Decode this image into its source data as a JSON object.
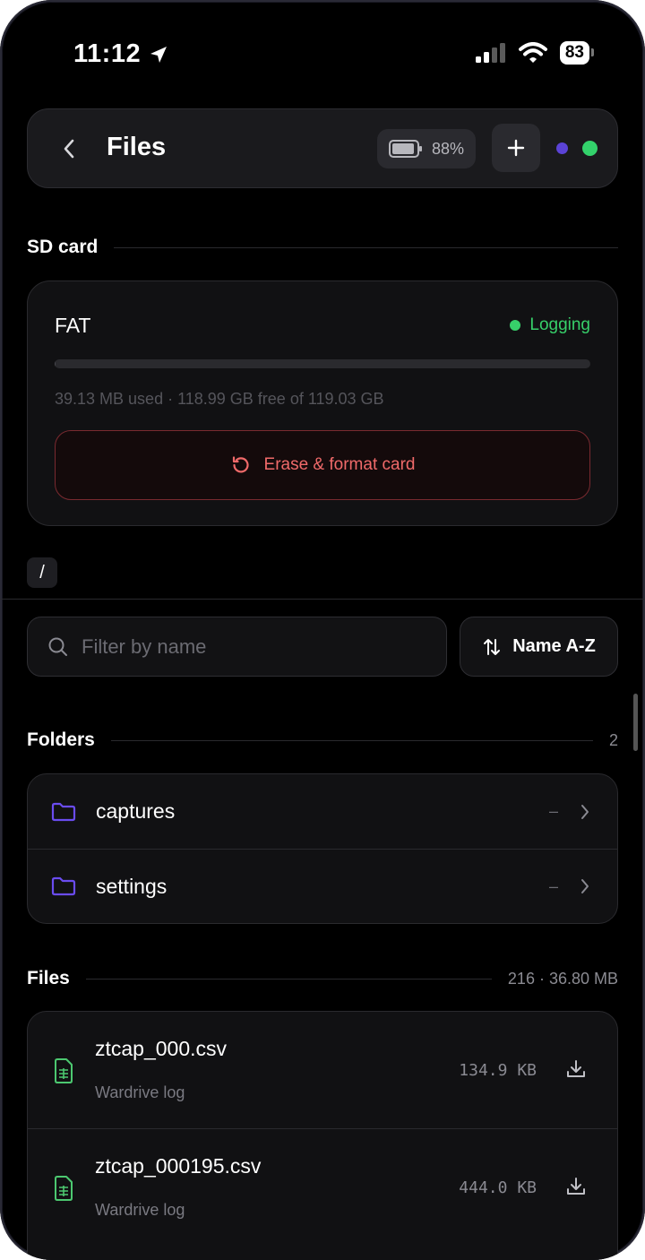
{
  "status_bar": {
    "time": "11:12",
    "battery": "83"
  },
  "header": {
    "title": "Files",
    "device_battery": "88%"
  },
  "sd_section": {
    "title": "SD card"
  },
  "sd_card": {
    "fs_type": "FAT",
    "status": "Logging",
    "usage_fraction": 0.0003,
    "usage_text": "39.13 MB used · 118.99 GB free of 119.03 GB",
    "erase_label": "Erase & format card"
  },
  "path": "/",
  "filter": {
    "placeholder": "Filter by name",
    "value": ""
  },
  "sort": {
    "label": "Name A-Z"
  },
  "folders": {
    "title": "Folders",
    "count": "2",
    "items": [
      {
        "name": "captures",
        "meta": "–"
      },
      {
        "name": "settings",
        "meta": "–"
      }
    ]
  },
  "files": {
    "title": "Files",
    "summary": "216 · 36.80 MB",
    "items": [
      {
        "name": "ztcap_000.csv",
        "type": "Wardrive log",
        "size": "134.9 KB"
      },
      {
        "name": "ztcap_000195.csv",
        "type": "Wardrive log",
        "size": "444.0 KB"
      }
    ]
  },
  "colors": {
    "accent_green": "#37d06a",
    "accent_purple": "#5b43d6",
    "danger": "#f06a6a",
    "folder_icon": "#6a4cf0",
    "file_icon": "#4cc870"
  }
}
